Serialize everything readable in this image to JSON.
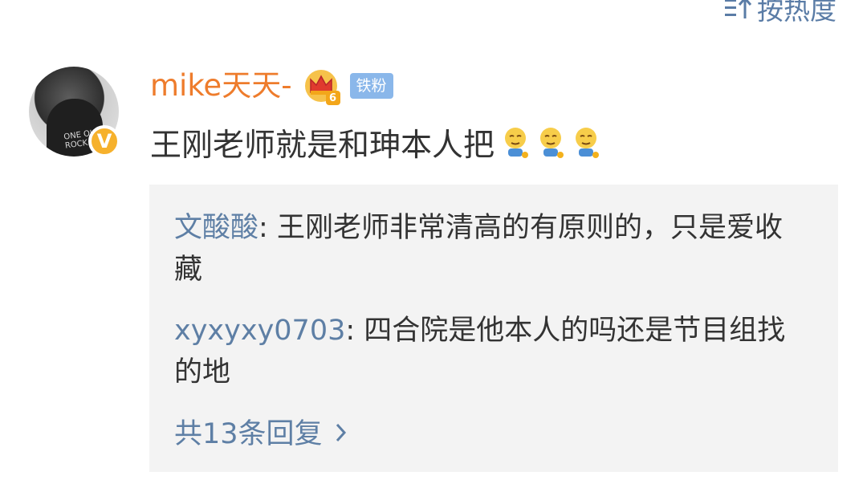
{
  "sort": {
    "label": "按热度",
    "icon": "sort-icon"
  },
  "comment": {
    "author": {
      "name": "mike天天-",
      "level": "6",
      "fan_badge": "铁粉",
      "verified_mark": "V"
    },
    "text": "王刚老师就是和珅本人把",
    "emoji_icons": [
      "smirk-emoji-icon",
      "smirk-emoji-icon",
      "smirk-emoji-icon"
    ],
    "replies": [
      {
        "author": "文酸酸",
        "separator": ": ",
        "text": "王刚老师非常清高的有原则的，只是爱收藏"
      },
      {
        "author": "xyxyxy0703",
        "separator": ": ",
        "text": "四合院是他本人的吗还是节目组找的地"
      }
    ],
    "more_replies_label": "共13条回复"
  },
  "colors": {
    "username": "#ee7c2c",
    "link": "#5e7fa5",
    "reply_bg": "#f3f3f3",
    "fan_badge_bg": "#8ab7ea",
    "verified_badge": "#f6b12c"
  }
}
